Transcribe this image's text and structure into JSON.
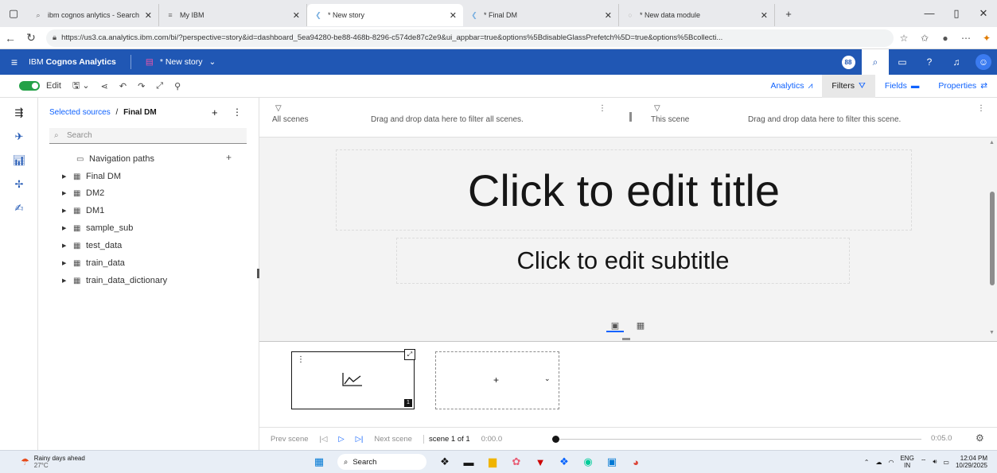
{
  "browser": {
    "tabs": [
      {
        "label": "ibm cognos anlytics - Search",
        "icon": "search-icon"
      },
      {
        "label": "My IBM",
        "icon": "ibm-icon"
      },
      {
        "label": "* New story",
        "icon": "cognos-icon",
        "active": true
      },
      {
        "label": "* Final DM",
        "icon": "cognos-icon"
      },
      {
        "label": "* New data module",
        "icon": "cognos-icon"
      }
    ],
    "url": "https://us3.ca.analytics.ibm.com/bi/?perspective=story&id=dashboard_5ea94280-be88-468b-8296-c574de87c2e9&ui_appbar=true&options%5BdisableGlassPrefetch%5D=true&options%5Bcollecti..."
  },
  "app": {
    "brand_prefix": "IBM ",
    "brand_name": "Cognos Analytics",
    "story_name": "* New story",
    "notification_count": "88"
  },
  "toolbar": {
    "edit_label": "Edit",
    "analytics_label": "Analytics",
    "filters_label": "Filters",
    "fields_label": "Fields",
    "properties_label": "Properties"
  },
  "sources": {
    "breadcrumb_link": "Selected sources",
    "breadcrumb_sep": "/",
    "breadcrumb_current": "Final DM",
    "search_placeholder": "Search",
    "nav_paths_label": "Navigation paths",
    "items": [
      "Final DM",
      "DM2",
      "DM1",
      "sample_sub",
      "test_data",
      "train_data",
      "train_data_dictionary"
    ]
  },
  "filters": {
    "all_scenes_label": "All scenes",
    "all_scenes_hint": "Drag and drop data here to filter all scenes.",
    "this_scene_label": "This scene",
    "this_scene_hint": "Drag and drop data here to filter this scene."
  },
  "canvas": {
    "title": "Click to edit title",
    "subtitle": "Click to edit subtitle"
  },
  "scenes": {
    "scene1_number": "1"
  },
  "playback": {
    "prev_label": "Prev scene",
    "next_label": "Next scene",
    "scene_count": "scene 1 of 1",
    "current_time": "0:00.0",
    "end_time": "0:05.0"
  },
  "taskbar": {
    "weather_title": "Rainy days ahead",
    "weather_temp": "27°C",
    "search_label": "Search",
    "lang_top": "ENG",
    "lang_bottom": "IN",
    "time": "12:04 PM",
    "date": "10/29/2025"
  },
  "colors": {
    "header_blue": "#2057b4",
    "link_blue": "#0f62fe",
    "toggle_green": "#24a148"
  }
}
